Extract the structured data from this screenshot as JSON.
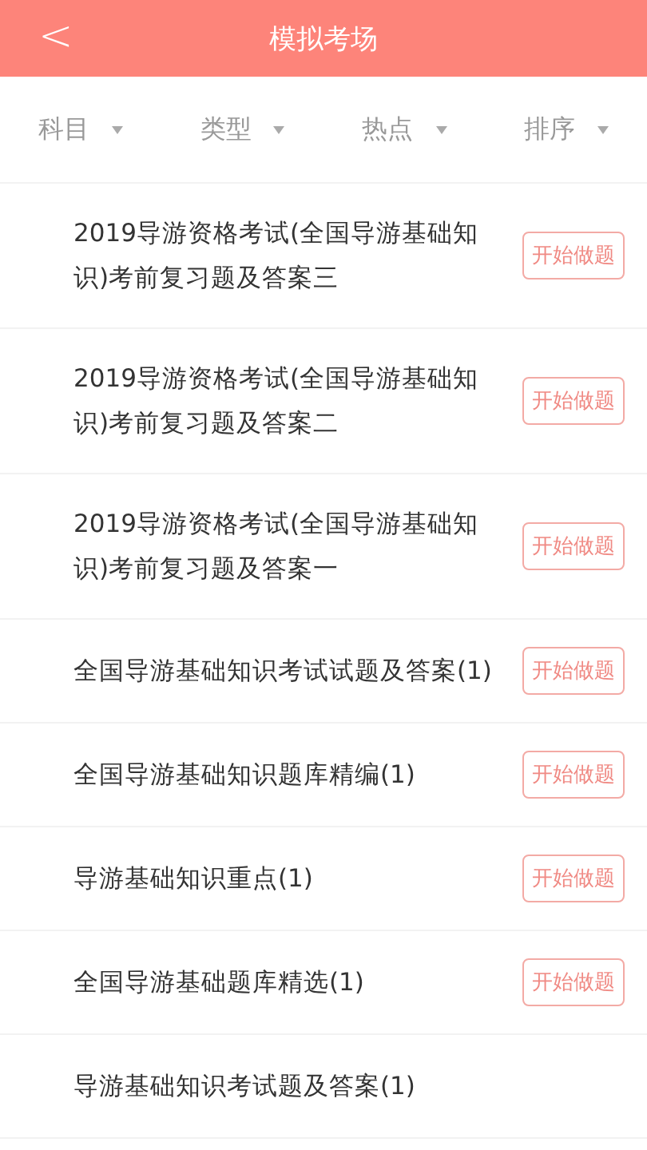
{
  "header": {
    "back": "<",
    "title": "模拟考场"
  },
  "filters": [
    {
      "label": "科目"
    },
    {
      "label": "类型"
    },
    {
      "label": "热点"
    },
    {
      "label": "排序"
    }
  ],
  "items": [
    {
      "title": "2019导游资格考试(全国导游基础知识)考前复习题及答案三",
      "button": "开始做题"
    },
    {
      "title": "2019导游资格考试(全国导游基础知识)考前复习题及答案二",
      "button": "开始做题"
    },
    {
      "title": "2019导游资格考试(全国导游基础知识)考前复习题及答案一",
      "button": "开始做题"
    },
    {
      "title": "全国导游基础知识考试试题及答案(1)",
      "button": "开始做题"
    },
    {
      "title": "全国导游基础知识题库精编(1)",
      "button": "开始做题"
    },
    {
      "title": "导游基础知识重点(1)",
      "button": "开始做题"
    },
    {
      "title": "全国导游基础题库精选(1)",
      "button": "开始做题"
    },
    {
      "title": "导游基础知识考试题及答案(1)"
    }
  ]
}
